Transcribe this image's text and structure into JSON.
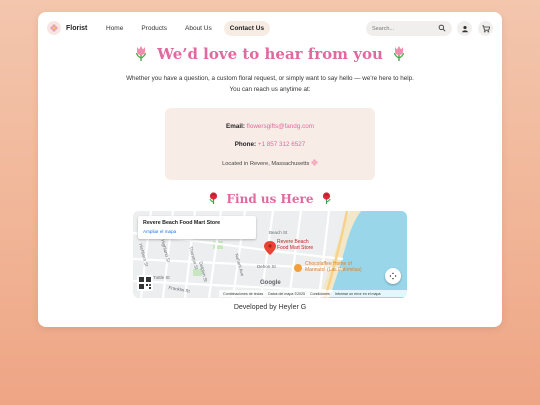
{
  "nav": {
    "brand": "Florist",
    "links": [
      "Home",
      "Products",
      "About Us",
      "Contact Us"
    ],
    "active_link": "Contact Us",
    "search_placeholder": "Search..."
  },
  "hero": {
    "title": "We’d love to hear from you",
    "text": "Whether you have a question, a custom floral request, or simply want to say hello — we're here to help. You can reach us anytime at:"
  },
  "contact": {
    "email_label": "Email:",
    "email": "flowersgifts@fandg.com",
    "phone_label": "Phone:",
    "phone": "+1 857 312 6527",
    "location": "Located in Revere, Massachusetts"
  },
  "find": {
    "title": "Find us Here"
  },
  "map": {
    "place_name": "Revere Beach Food Mart Store",
    "place_link": "Ampliar el mapa",
    "pin_label_line1": "Revere Beach",
    "pin_label_line2": "Food Mart Store",
    "coffee_line1": "Chocolaffee Home of",
    "coffee_line2": "Mannuts! (Las Palomitas)",
    "streets": [
      "Beach St",
      "Dehon St",
      "Nahant Ave",
      "Thornton St",
      "Highland St",
      "Hichborn St",
      "Dolphin St",
      "Tuttle St",
      "Franklin St"
    ],
    "google": "Google",
    "footer": [
      "Combinaciones de teclas",
      "Datos del mapa ©2025",
      "Condiciones",
      "Informar un error en el mapa"
    ]
  },
  "footer": {
    "credit": "Developed by Heyler G"
  },
  "colors": {
    "accent": "#e06a9f",
    "contact_bg": "#f8ece6",
    "page_bg": "#f3c6ad"
  }
}
